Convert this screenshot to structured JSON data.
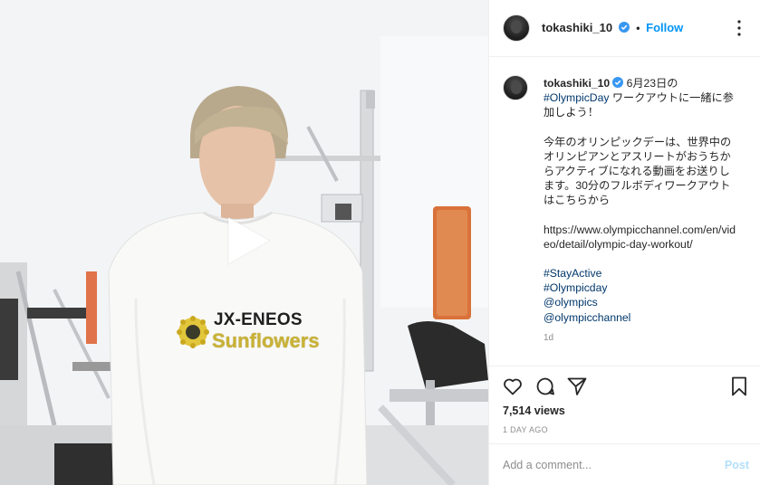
{
  "post": {
    "username": "tokashiki_10",
    "follow_label": "Follow",
    "separator": "•",
    "verified_icon": "verified-badge-icon",
    "more_icon": "more-options-icon"
  },
  "video": {
    "play_icon": "play-icon",
    "shirt_brand": "JX-ENEOS",
    "shirt_team": "Sunflowers"
  },
  "caption": {
    "username": "tokashiki_10",
    "line1_after_user": "6月23日の",
    "hashtag_olympicday": "#OlympicDay",
    "line1_rest": " ワークアウトに一緒に参加しよう！",
    "paragraph2": "今年のオリンピックデーは、世界中のオリンピアンとアスリートがおうちからアクティブになれる動画をお送りします。30分のフルボディワークアウトはこちらから",
    "url": "https://www.olympicchannel.com/en/video/detail/olympic-day-workout/",
    "tags": [
      "#StayActive",
      "#Olympicday",
      "@olympics",
      "@olympicchannel"
    ],
    "time_ago": "1d"
  },
  "actions": {
    "like_icon": "heart-icon",
    "comment_icon": "comment-icon",
    "share_icon": "share-icon",
    "save_icon": "bookmark-icon",
    "views": "7,514 views",
    "posted": "1 DAY AGO"
  },
  "comment": {
    "placeholder": "Add a comment...",
    "post_label": "Post"
  },
  "colors": {
    "accent": "#0095f6",
    "link": "#00376b",
    "muted": "#8e8e8e",
    "post_disabled": "#b2dffc"
  }
}
